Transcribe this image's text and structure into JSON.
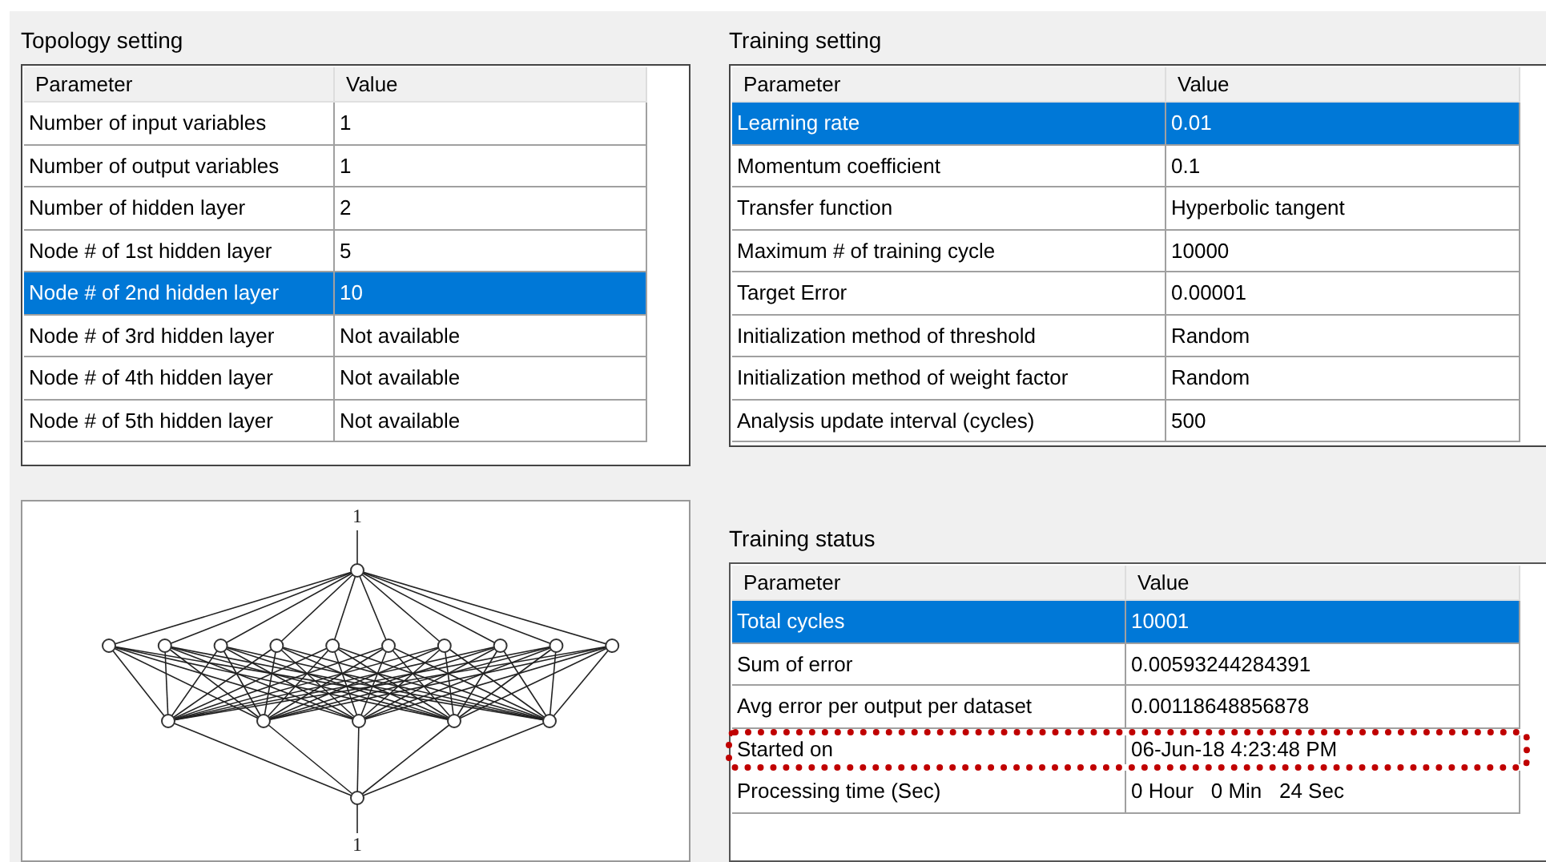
{
  "topology_setting": {
    "title": "Topology setting",
    "columns": [
      "Parameter",
      "Value"
    ],
    "rows": [
      {
        "parameter": "Number of input variables",
        "value": "1",
        "selected": false
      },
      {
        "parameter": "Number of output variables",
        "value": "1",
        "selected": false
      },
      {
        "parameter": "Number of hidden layer",
        "value": "2",
        "selected": false
      },
      {
        "parameter": "Node # of 1st hidden layer",
        "value": "5",
        "selected": false
      },
      {
        "parameter": "Node # of 2nd hidden layer",
        "value": "10",
        "selected": true
      },
      {
        "parameter": "Node # of 3rd hidden layer",
        "value": "Not available",
        "selected": false
      },
      {
        "parameter": "Node # of 4th hidden layer",
        "value": "Not available",
        "selected": false
      },
      {
        "parameter": "Node # of 5th hidden layer",
        "value": "Not available",
        "selected": false
      }
    ]
  },
  "training_setting": {
    "title": "Training setting",
    "columns": [
      "Parameter",
      "Value"
    ],
    "rows": [
      {
        "parameter": "Learning rate",
        "value": "0.01",
        "selected": true
      },
      {
        "parameter": "Momentum coefficient",
        "value": "0.1",
        "selected": false
      },
      {
        "parameter": "Transfer function",
        "value": "Hyperbolic tangent",
        "selected": false
      },
      {
        "parameter": "Maximum # of training cycle",
        "value": "10000",
        "selected": false
      },
      {
        "parameter": "Target Error",
        "value": "0.00001",
        "selected": false
      },
      {
        "parameter": "Initialization method of threshold",
        "value": "Random",
        "selected": false
      },
      {
        "parameter": "Initialization method of weight factor",
        "value": "Random",
        "selected": false
      },
      {
        "parameter": "Analysis update interval (cycles)",
        "value": "500",
        "selected": false
      }
    ]
  },
  "network_diagram": {
    "input_label": "1",
    "output_label": "1"
  },
  "training_status": {
    "title": "Training status",
    "columns": [
      "Parameter",
      "Value"
    ],
    "rows": [
      {
        "parameter": "Total cycles",
        "value": "10001",
        "selected": true,
        "highlighted": false
      },
      {
        "parameter": "Sum of error",
        "value": "0.00593244284391",
        "selected": false,
        "highlighted": false
      },
      {
        "parameter": "Avg error per output per dataset",
        "value": "0.00118648856878",
        "selected": false,
        "highlighted": false
      },
      {
        "parameter": "Started on",
        "value": "06-Jun-18 4:23:48 PM",
        "selected": false,
        "highlighted": true
      },
      {
        "parameter": "Processing time (Sec)",
        "value": "0 Hour   0 Min   24 Sec",
        "selected": false,
        "highlighted": false
      }
    ]
  }
}
